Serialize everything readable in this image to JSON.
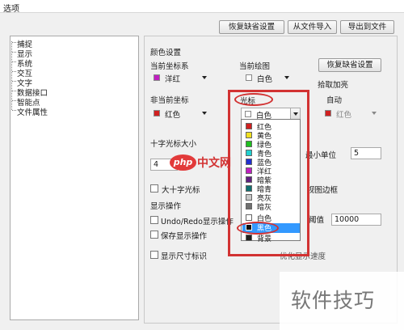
{
  "window": {
    "title": "选项"
  },
  "toolbar": {
    "restore_defaults": "恢复缺省设置",
    "import": "从文件导入",
    "export": "导出到文件"
  },
  "tree": {
    "items": [
      {
        "label": "捕捉"
      },
      {
        "label": "显示"
      },
      {
        "label": "系统"
      },
      {
        "label": "交互"
      },
      {
        "label": "文字"
      },
      {
        "label": "数据接口"
      },
      {
        "label": "智能点"
      },
      {
        "label": "文件属性"
      }
    ]
  },
  "color_settings": {
    "section_title": "颜色设置",
    "current_coord_label": "当前坐标系",
    "current_coord_value": "洋红",
    "current_coord_color": "#c020c0",
    "current_draw_label": "当前绘图",
    "current_draw_value": "白色",
    "current_draw_color": "#ffffff",
    "restore_defaults": "恢复缺省设置",
    "non_current_coord_label": "非当前坐标",
    "non_current_coord_value": "红色",
    "non_current_coord_color": "#d02020",
    "cursor_label": "光标",
    "cursor_value": "白色",
    "cursor_color": "#ffffff",
    "pick_highlight_label": "拾取加亮",
    "auto_label": "自动",
    "highlight_value": "红色",
    "highlight_color": "#d02020"
  },
  "cursor_size": {
    "label": "十字光标大小",
    "value": "4",
    "unit_label": "最小单位",
    "unit_value": "5",
    "big_cross_label": "大十字光标",
    "border_label": "视图边框"
  },
  "display_ops": {
    "section_title": "显示操作",
    "undo_redo_label": "Undo/Redo显示操作",
    "save_display_label": "保存显示操作",
    "threshold_label": "阈值",
    "threshold_value": "10000",
    "show_size_label": "显示尺寸标识",
    "speed_label": "优化显示速度"
  },
  "dropdown": {
    "items": [
      {
        "label": "红色",
        "color": "#d02020"
      },
      {
        "label": "黄色",
        "color": "#f0e020"
      },
      {
        "label": "绿色",
        "color": "#20c020"
      },
      {
        "label": "青色",
        "color": "#20d0d0"
      },
      {
        "label": "蓝色",
        "color": "#2030d0"
      },
      {
        "label": "洋红",
        "color": "#c020c0"
      },
      {
        "label": "暗紫",
        "color": "#602080"
      },
      {
        "label": "暗青",
        "color": "#107070"
      },
      {
        "label": "亮灰",
        "color": "#c8c8c8"
      },
      {
        "label": "暗灰",
        "color": "#707070"
      },
      {
        "label": "白色",
        "color": "#ffffff"
      },
      {
        "label": "黑色",
        "color": "#101010"
      },
      {
        "label": "背景",
        "color": "#202020"
      }
    ],
    "selected_index": 11
  },
  "watermarks": {
    "php_logo": "php",
    "php_cn": "中文网",
    "corner": "软件技巧"
  },
  "accent": {
    "annotation": "#d23232",
    "selection": "#3399ff"
  }
}
